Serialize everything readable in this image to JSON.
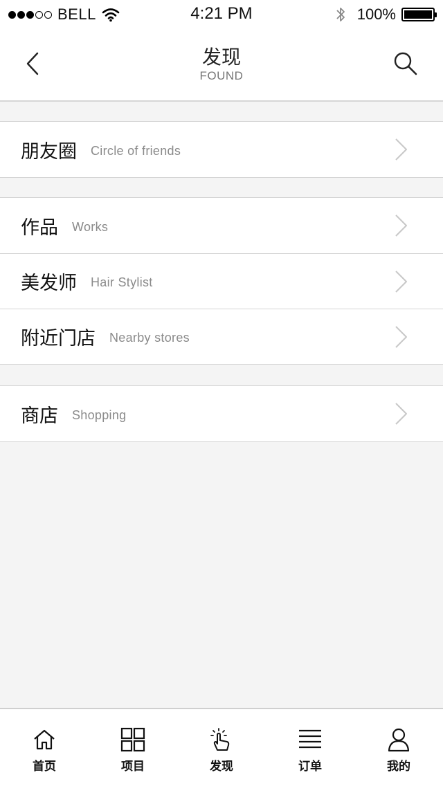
{
  "status_bar": {
    "carrier": "BELL",
    "time": "4:21 PM",
    "battery_percent": "100%",
    "battery_level": 1.0,
    "signal_bars_filled": 3,
    "signal_bars_total": 5
  },
  "nav": {
    "title": "发现",
    "subtitle": "FOUND",
    "back_icon": "chevron-left-icon",
    "search_icon": "search-icon"
  },
  "groups": [
    {
      "items": [
        {
          "zh": "朋友圈",
          "en": "Circle of friends"
        }
      ]
    },
    {
      "items": [
        {
          "zh": "作品",
          "en": "Works"
        },
        {
          "zh": "美发师",
          "en": "Hair Stylist"
        },
        {
          "zh": "附近门店",
          "en": "Nearby stores"
        }
      ]
    },
    {
      "items": [
        {
          "zh": "商店",
          "en": "Shopping"
        }
      ]
    }
  ],
  "tab_bar": {
    "tabs": [
      {
        "label": "首页",
        "icon": "home-icon"
      },
      {
        "label": "项目",
        "icon": "grid-icon"
      },
      {
        "label": "发现",
        "icon": "tap-hand-icon"
      },
      {
        "label": "订单",
        "icon": "list-icon"
      },
      {
        "label": "我的",
        "icon": "user-icon"
      }
    ]
  },
  "colors": {
    "background": "#f4f4f4",
    "surface": "#ffffff",
    "divider": "#d4d4d4",
    "chevron": "#c8c8c8",
    "secondary_text": "#8a8a8a"
  }
}
